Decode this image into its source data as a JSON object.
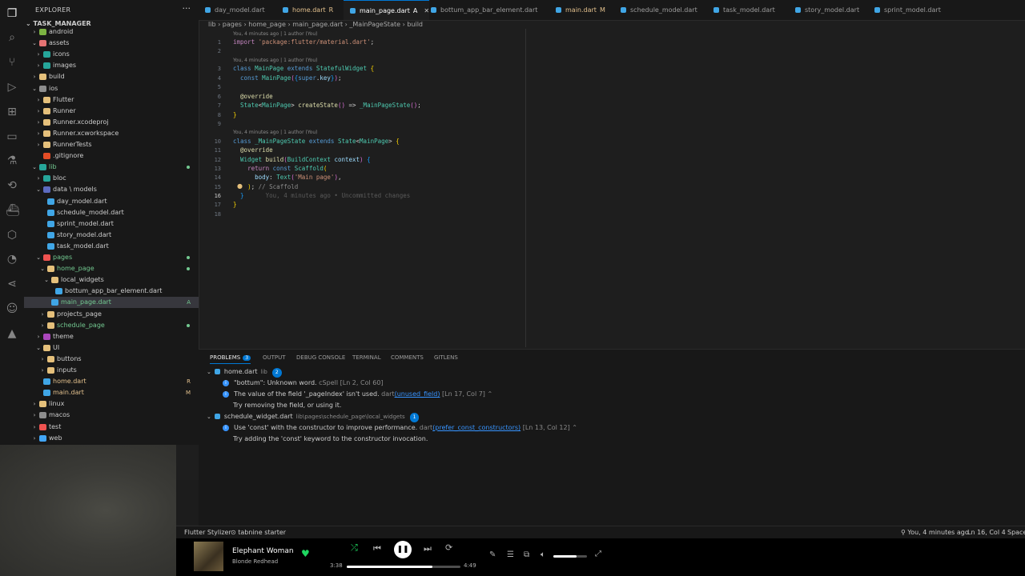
{
  "sidebar": {
    "title": "EXPLORER",
    "more": "···",
    "section": "TASK_MANAGER",
    "items": [
      {
        "label": "android",
        "depth": 1,
        "twisty": "›",
        "color": "#7cb342",
        "status": "",
        "row": 0
      },
      {
        "label": "assets",
        "depth": 1,
        "twisty": "⌄",
        "color": "#e57373",
        "status": "",
        "row": 1
      },
      {
        "label": "icons",
        "depth": 2,
        "twisty": "›",
        "color": "#26a69a",
        "status": "",
        "row": 2
      },
      {
        "label": "images",
        "depth": 2,
        "twisty": "›",
        "color": "#26a69a",
        "status": "",
        "row": 3
      },
      {
        "label": "build",
        "depth": 1,
        "twisty": "›",
        "color": "#e5c07b",
        "status": "",
        "row": 4
      },
      {
        "label": "ios",
        "depth": 1,
        "twisty": "⌄",
        "color": "#8e8e8e",
        "status": "",
        "row": 5
      },
      {
        "label": "Flutter",
        "depth": 2,
        "twisty": "›",
        "color": "#e5c07b",
        "status": "",
        "row": 6
      },
      {
        "label": "Runner",
        "depth": 2,
        "twisty": "›",
        "color": "#e5c07b",
        "status": "",
        "row": 7
      },
      {
        "label": "Runner.xcodeproj",
        "depth": 2,
        "twisty": "›",
        "color": "#e5c07b",
        "status": "",
        "row": 8
      },
      {
        "label": "Runner.xcworkspace",
        "depth": 2,
        "twisty": "›",
        "color": "#e5c07b",
        "status": "",
        "row": 9
      },
      {
        "label": "RunnerTests",
        "depth": 2,
        "twisty": "›",
        "color": "#e5c07b",
        "status": "",
        "row": 10
      },
      {
        "label": ".gitignore",
        "depth": 2,
        "twisty": "",
        "color": "#e44d26",
        "status": "",
        "row": 11
      },
      {
        "label": "lib",
        "depth": 1,
        "twisty": "⌄",
        "color": "#26a69a",
        "status": "dot",
        "row": 12
      },
      {
        "label": "bloc",
        "depth": 2,
        "twisty": "›",
        "color": "#26a69a",
        "status": "",
        "row": 13
      },
      {
        "label": "data \\ models",
        "depth": 2,
        "twisty": "⌄",
        "color": "#5c6bc0",
        "status": "",
        "row": 14
      },
      {
        "label": "day_model.dart",
        "depth": 3,
        "twisty": "",
        "color": "#40a6e6",
        "status": "",
        "row": 15
      },
      {
        "label": "schedule_model.dart",
        "depth": 3,
        "twisty": "",
        "color": "#40a6e6",
        "status": "",
        "row": 16
      },
      {
        "label": "sprint_model.dart",
        "depth": 3,
        "twisty": "",
        "color": "#40a6e6",
        "status": "",
        "row": 17
      },
      {
        "label": "story_model.dart",
        "depth": 3,
        "twisty": "",
        "color": "#40a6e6",
        "status": "",
        "row": 18
      },
      {
        "label": "task_model.dart",
        "depth": 3,
        "twisty": "",
        "color": "#40a6e6",
        "status": "",
        "row": 19
      },
      {
        "label": "pages",
        "depth": 2,
        "twisty": "⌄",
        "color": "#ef5350",
        "status": "dot",
        "row": 20
      },
      {
        "label": "home_page",
        "depth": 3,
        "twisty": "⌄",
        "color": "#e5c07b",
        "status": "dot",
        "row": 21
      },
      {
        "label": "local_widgets",
        "depth": 4,
        "twisty": "⌄",
        "color": "#e5c07b",
        "status": "",
        "row": 22
      },
      {
        "label": "bottum_app_bar_element.dart",
        "depth": 5,
        "twisty": "",
        "color": "#40a6e6",
        "status": "",
        "row": 23
      },
      {
        "label": "main_page.dart",
        "depth": 4,
        "twisty": "",
        "color": "#40a6e6",
        "status": "A",
        "row": 24
      },
      {
        "label": "projects_page",
        "depth": 3,
        "twisty": "›",
        "color": "#e5c07b",
        "status": "",
        "row": 25
      },
      {
        "label": "schedule_page",
        "depth": 3,
        "twisty": "›",
        "color": "#e5c07b",
        "status": "dot",
        "row": 26
      },
      {
        "label": "theme",
        "depth": 2,
        "twisty": "›",
        "color": "#ab47bc",
        "status": "",
        "row": 27
      },
      {
        "label": "UI",
        "depth": 2,
        "twisty": "⌄",
        "color": "#e5c07b",
        "status": "",
        "row": 28
      },
      {
        "label": "buttons",
        "depth": 3,
        "twisty": "›",
        "color": "#e5c07b",
        "status": "",
        "row": 29
      },
      {
        "label": "inputs",
        "depth": 3,
        "twisty": "›",
        "color": "#e5c07b",
        "status": "",
        "row": 30
      },
      {
        "label": "home.dart",
        "depth": 2,
        "twisty": "",
        "color": "#40a6e6",
        "status": "R",
        "row": 31
      },
      {
        "label": "main.dart",
        "depth": 2,
        "twisty": "",
        "color": "#40a6e6",
        "status": "M",
        "row": 32
      },
      {
        "label": "linux",
        "depth": 1,
        "twisty": "›",
        "color": "#e5c07b",
        "status": "",
        "row": 33
      },
      {
        "label": "macos",
        "depth": 1,
        "twisty": "›",
        "color": "#8e8e8e",
        "status": "",
        "row": 34
      },
      {
        "label": "test",
        "depth": 1,
        "twisty": "›",
        "color": "#ef5350",
        "status": "",
        "row": 35
      },
      {
        "label": "web",
        "depth": 1,
        "twisty": "›",
        "color": "#42a5f5",
        "status": "",
        "row": 36
      }
    ]
  },
  "tabs": [
    {
      "label": "day_model.dart",
      "badge": "",
      "color": "#9d9d9d"
    },
    {
      "label": "home.dart",
      "badge": "R",
      "color": "#e2c08d"
    },
    {
      "label": "main_page.dart",
      "badge": "A",
      "color": "#ffffff"
    },
    {
      "label": "bottum_app_bar_element.dart",
      "badge": "",
      "color": "#9d9d9d"
    },
    {
      "label": "main.dart",
      "badge": "M",
      "color": "#e2c08d"
    },
    {
      "label": "schedule_model.dart",
      "badge": "",
      "color": "#9d9d9d"
    },
    {
      "label": "task_model.dart",
      "badge": "",
      "color": "#9d9d9d"
    },
    {
      "label": "story_model.dart",
      "badge": "",
      "color": "#9d9d9d"
    },
    {
      "label": "sprint_model.dart",
      "badge": "",
      "color": "#9d9d9d"
    }
  ],
  "breadcrumb": "lib › pages › home_page › main_page.dart › _MainPageState › build",
  "editor": {
    "blame": {
      "b1": "You, 4 minutes ago | 1 author (You)",
      "b2": "You, 4 minutes ago | 1 author (You)",
      "b3": "You, 4 minutes ago | 1 author (You)"
    },
    "line_numbers": [
      "1",
      "2",
      "3",
      "4",
      "5",
      "6",
      "7",
      "8",
      "9",
      "10",
      "11",
      "12",
      "13",
      "14",
      "15",
      "16",
      "17",
      "18"
    ],
    "ghost_text": "You, 4 minutes ago • Uncommitted changes",
    "cursor_line": "16"
  },
  "panel": {
    "tabs": {
      "problems": "PROBLEMS",
      "problems_count": "3",
      "output": "OUTPUT",
      "debug": "DEBUG CONSOLE",
      "terminal": "TERMINAL",
      "comments": "COMMENTS",
      "gitlens": "GITLENS"
    },
    "groups": [
      {
        "file": "home.dart",
        "path": "lib",
        "count": "2",
        "items": [
          {
            "msg": "\"bottum\": Unknown word.",
            "source": "cSpell",
            "link": "",
            "loc": "[Ln 2, Col 60]"
          },
          {
            "msg": "The value of the field '_pageIndex' isn't used.",
            "source": "dart",
            "link": "(unused_field)",
            "loc": "[Ln 17, Col 7]",
            "hint": "Try removing the field, or using it."
          }
        ]
      },
      {
        "file": "schedule_widget.dart",
        "path": "lib\\pages\\schedule_page\\local_widgets",
        "count": "1",
        "items": [
          {
            "msg": "Use 'const' with the constructor to improve performance.",
            "source": "dart",
            "link": "(prefer_const_constructors)",
            "loc": "[Ln 13, Col 12]",
            "hint": "Try adding the 'const' keyword to the constructor invocation."
          }
        ]
      }
    ]
  },
  "statusbar": {
    "flutter_stylizer": "Flutter Stylizer",
    "tabnine": "⊙ tabnine starter",
    "blame": "⚲ You, 4 minutes ago",
    "position": "Ln 16, Col 4",
    "spaces": "Space"
  },
  "player": {
    "song": "Elephant Woman",
    "artist": "Blonde Redhead",
    "elapsed": "3:38",
    "duration": "4:49",
    "progress": 0.755,
    "volume": 0.7,
    "accent": "#1ed760"
  }
}
